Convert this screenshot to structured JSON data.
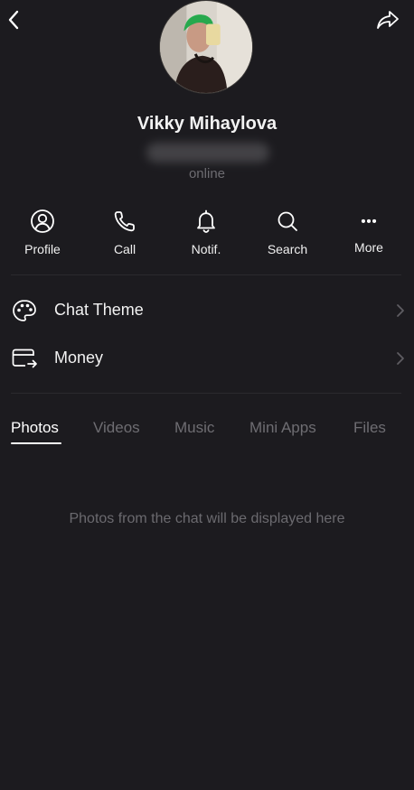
{
  "header": {
    "back_icon": "chevron-left-icon",
    "share_icon": "share-arrow-icon"
  },
  "profile": {
    "name": "Vikky Mihaylova",
    "status": "online"
  },
  "actions": [
    {
      "label": "Profile",
      "icon": "user-circle-icon"
    },
    {
      "label": "Call",
      "icon": "phone-icon"
    },
    {
      "label": "Notif.",
      "icon": "bell-icon"
    },
    {
      "label": "Search",
      "icon": "search-icon"
    },
    {
      "label": "More",
      "icon": "more-dots-icon"
    }
  ],
  "menu": [
    {
      "label": "Chat Theme",
      "icon": "palette-icon"
    },
    {
      "label": "Money",
      "icon": "wallet-icon"
    }
  ],
  "tabs": [
    {
      "label": "Photos",
      "active": true
    },
    {
      "label": "Videos",
      "active": false
    },
    {
      "label": "Music",
      "active": false
    },
    {
      "label": "Mini Apps",
      "active": false
    },
    {
      "label": "Files",
      "active": false
    }
  ],
  "empty_state": "Photos from the chat will be displayed here",
  "colors": {
    "background": "#1c1b1f",
    "text_primary": "#ffffff",
    "text_muted": "#6e6d72",
    "divider": "#2b2a2e"
  }
}
